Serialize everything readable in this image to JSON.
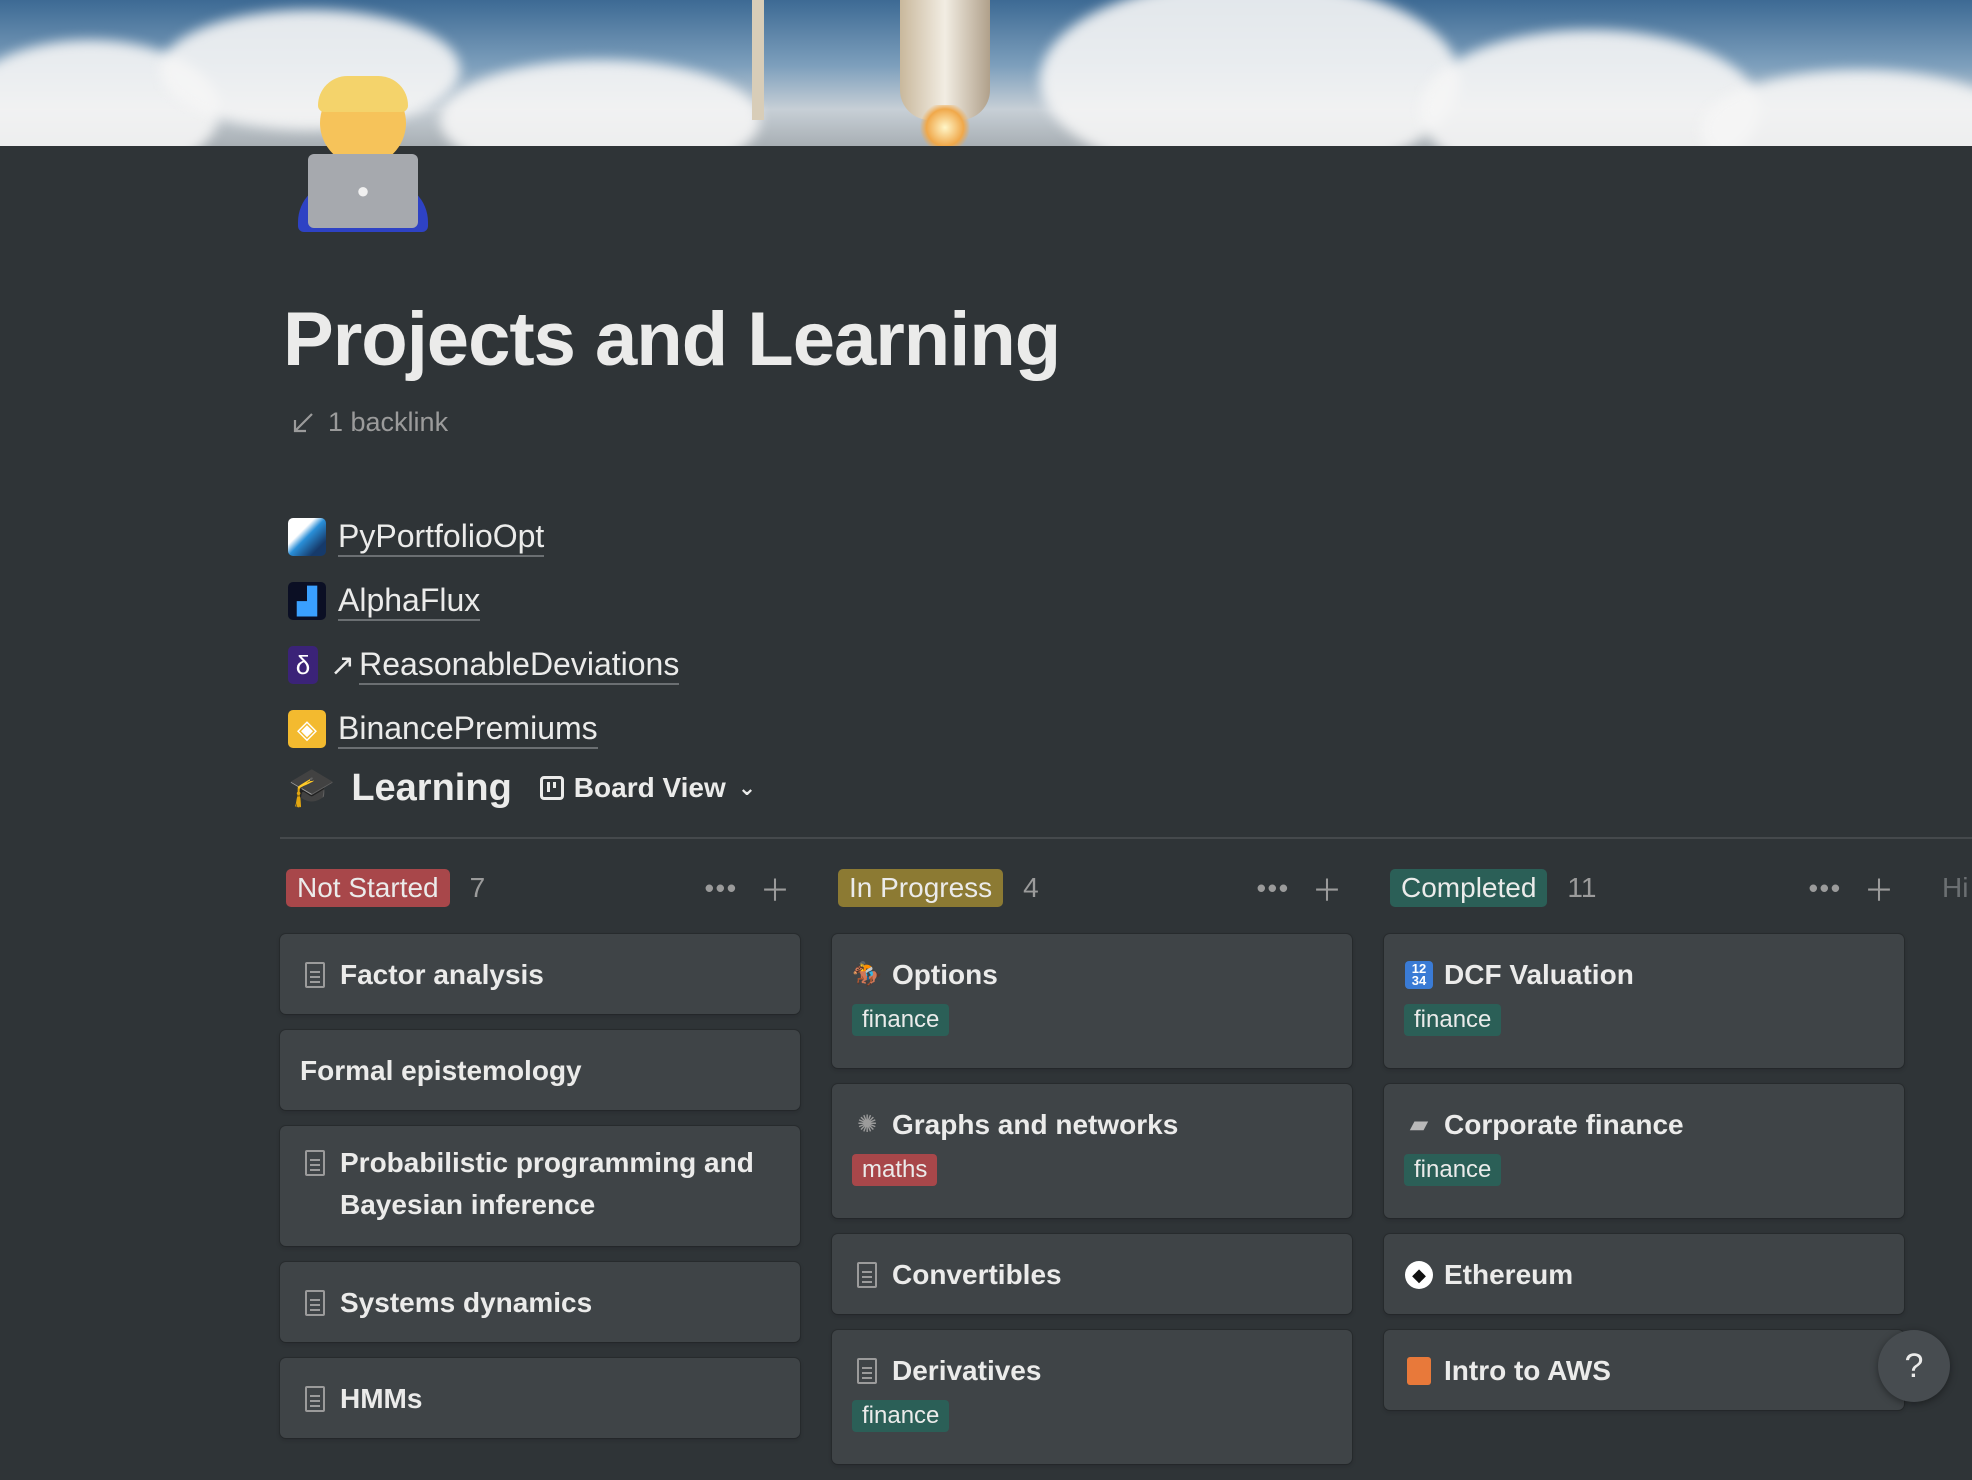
{
  "page": {
    "title": "Projects and Learning",
    "backlink": "1 backlink"
  },
  "links": [
    {
      "label": "PyPortfolioOpt",
      "icon": "pyportfolioopt-logo"
    },
    {
      "label": "AlphaFlux",
      "icon": "alphaflux-logo"
    },
    {
      "label": "ReasonableDeviations",
      "icon": "delta-icon",
      "external": true
    },
    {
      "label": "BinancePremiums",
      "icon": "binance-logo"
    }
  ],
  "database": {
    "title": "Learning",
    "view": "Board View",
    "hidden_label": "Hi"
  },
  "columns": [
    {
      "status": "Not Started",
      "count": "7",
      "color": "#a8474a",
      "cards": [
        {
          "title": "Factor analysis",
          "icon": "page"
        },
        {
          "title": "Formal epistemology",
          "icon": ""
        },
        {
          "title": "Probabilistic programming and Bayesian inference",
          "icon": "page"
        },
        {
          "title": "Systems dynamics",
          "icon": "page"
        },
        {
          "title": "HMMs",
          "icon": "page"
        }
      ]
    },
    {
      "status": "In Progress",
      "count": "4",
      "color": "#8c7a33",
      "cards": [
        {
          "title": "Options",
          "icon": "horse-rider",
          "tag": "finance"
        },
        {
          "title": "Graphs and networks",
          "icon": "spider-web",
          "tag": "maths"
        },
        {
          "title": "Convertibles",
          "icon": "page"
        },
        {
          "title": "Derivatives",
          "icon": "page",
          "tag": "finance"
        }
      ]
    },
    {
      "status": "Completed",
      "count": "11",
      "color": "#2b5f57",
      "cards": [
        {
          "title": "DCF Valuation",
          "icon": "numbers",
          "tag": "finance"
        },
        {
          "title": "Corporate finance",
          "icon": "folder",
          "tag": "finance"
        },
        {
          "title": "Ethereum",
          "icon": "ethereum"
        },
        {
          "title": "Intro to AWS",
          "icon": "aws"
        }
      ]
    }
  ],
  "help": "?"
}
